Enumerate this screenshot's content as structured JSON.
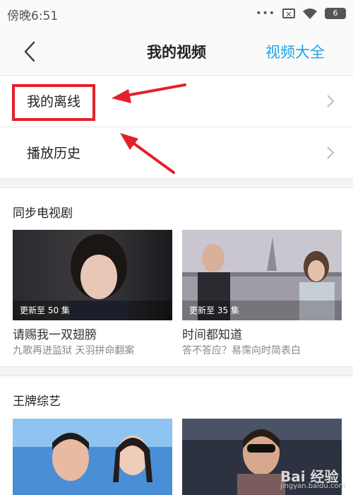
{
  "status_bar": {
    "time": "傍晚6:51",
    "dots": "•••",
    "battery": "6"
  },
  "nav": {
    "title": "我的视频",
    "right_link": "视频大全"
  },
  "menu": [
    {
      "label": "我的离线"
    },
    {
      "label": "播放历史"
    }
  ],
  "sections": [
    {
      "title": "同步电视剧",
      "cards": [
        {
          "badge": "更新至 50 集",
          "title": "请赐我一双翅膀",
          "subtitle": "九歌再进监狱 天羽拼命翻案"
        },
        {
          "badge": "更新至 35 集",
          "title": "时间都知道",
          "subtitle": "答不答应？易霈向时简表白"
        }
      ]
    },
    {
      "title": "王牌综艺"
    }
  ],
  "watermark": {
    "text": "Bai 经验",
    "url": "jingyan.baidu.com"
  },
  "colors": {
    "accent": "#1ca2e8",
    "highlight": "#e3212b"
  }
}
